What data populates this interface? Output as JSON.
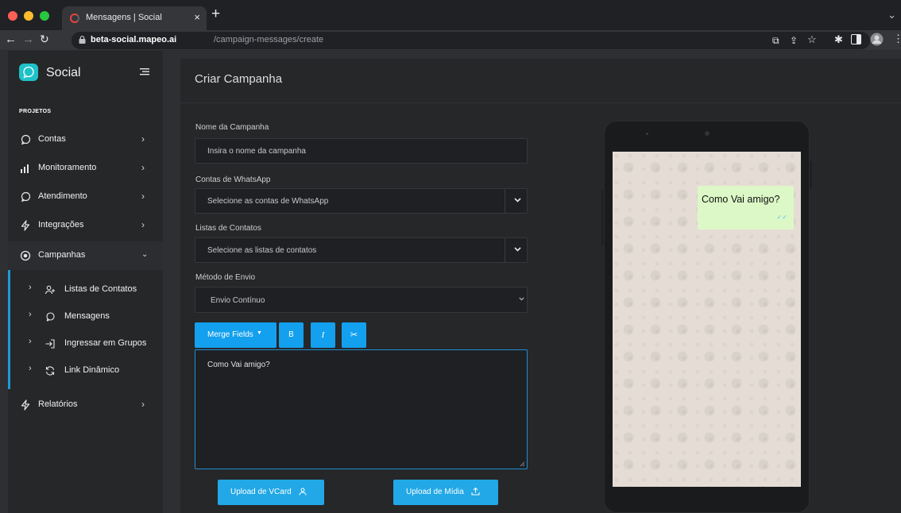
{
  "browser": {
    "tab_title": "Mensagens | Social",
    "tab_close": "×",
    "new_tab": "+",
    "url_host": "beta-social.mapeo.ai",
    "url_path": "/campaign-messages/create"
  },
  "colors": {
    "accent": "#13a0ee",
    "logo": "#1fc1c9",
    "bubble": "#dcf8c6",
    "sidebar_active_bar": "#1d9bd9"
  },
  "sidebar": {
    "brand": "Social",
    "section": "PROJETOS",
    "items": [
      {
        "label": "Contas",
        "icon": "chat-bubble-icon"
      },
      {
        "label": "Monitoramento",
        "icon": "bar-chart-icon"
      },
      {
        "label": "Atendimento",
        "icon": "chat-bubble-icon"
      },
      {
        "label": "Integrações",
        "icon": "lightning-icon"
      },
      {
        "label": "Campanhas",
        "icon": "target-icon"
      },
      {
        "label": "Relatórios",
        "icon": "lightning-icon"
      }
    ],
    "subitems": [
      {
        "label": "Listas de Contatos",
        "icon": "user-plus-icon"
      },
      {
        "label": "Mensagens",
        "icon": "chat-bubble-icon"
      },
      {
        "label": "Ingressar em Grupos",
        "icon": "login-icon"
      },
      {
        "label": "Link Dinâmico",
        "icon": "refresh-icon"
      }
    ]
  },
  "form": {
    "title": "Criar Campanha",
    "campaign_name_label": "Nome da Campanha",
    "campaign_name_placeholder": "Insira o nome da campanha",
    "whatsapp_label": "Contas de WhatsApp",
    "whatsapp_placeholder": "Selecione as contas de WhatsApp",
    "lists_label": "Listas de Contatos",
    "lists_placeholder": "Selecione as listas de contatos",
    "method_label": "Método de Envio",
    "method_value": "Envio Contínuo",
    "merge_fields": "Merge Fields",
    "bold": "B",
    "italic": "I",
    "message": "Como Vai amigo?",
    "upload_vcard": "Upload de VCard",
    "upload_media": "Upload de Mídia"
  },
  "preview": {
    "message": "Como Vai amigo?",
    "ticks": "✓✓"
  }
}
